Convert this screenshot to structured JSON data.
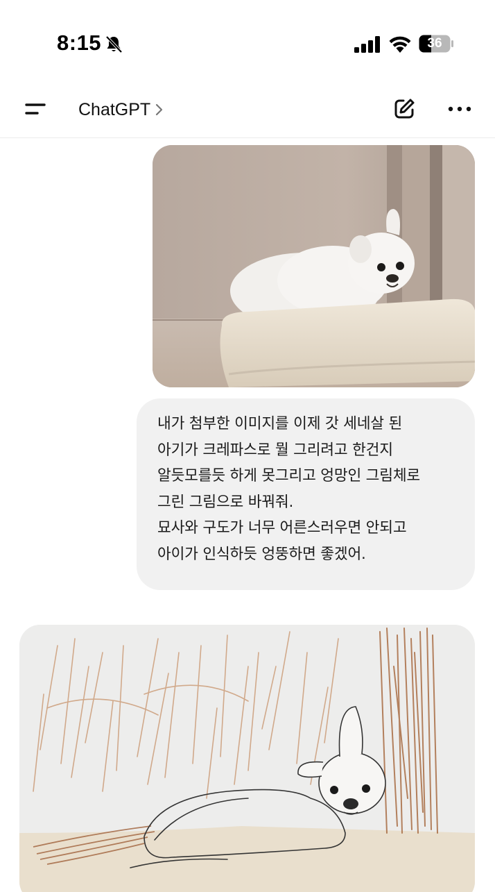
{
  "status_bar": {
    "time": "8:15",
    "battery": "36",
    "icons": [
      "bell-slash-icon",
      "cellular-signal-icon",
      "wifi-icon",
      "battery-icon"
    ]
  },
  "header": {
    "title": "ChatGPT",
    "icons": [
      "menu-icon",
      "chevron-right-icon",
      "new-chat-edit-icon",
      "more-options-icon"
    ]
  },
  "conversation": {
    "user_message": {
      "lines": [
        "내가 첨부한 이미지를 이제 갓 세네살 된",
        "아기가 크레파스로 뭘 그리려고 한건지",
        "알듯모를듯 하게 못그리고 엉망인 그림체로",
        "그린 그림으로 바꿔줘.",
        "묘사와 구도가 너무 어른스러우면 안되고",
        "아이가 인식하듯 엉뚱하면 좋겠어."
      ]
    }
  },
  "colors": {
    "background": "#ffffff",
    "bubble": "#f1f1f1",
    "text": "#1a1a1a",
    "divider": "#ececec"
  }
}
